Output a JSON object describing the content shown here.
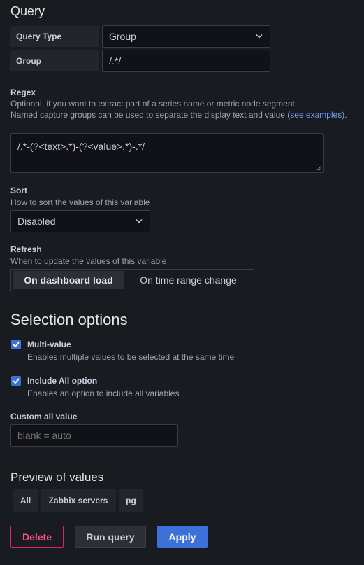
{
  "query": {
    "title": "Query",
    "query_type_label": "Query Type",
    "query_type_value": "Group",
    "group_label": "Group",
    "group_value": "/.*/"
  },
  "regex": {
    "label": "Regex",
    "help_line1": "Optional, if you want to extract part of a series name or metric node segment.",
    "help_line2_prefix": "Named capture groups can be used to separate the display text and value (",
    "help_link": "see examples",
    "help_suffix": ").",
    "value": "/.*-(?<text>.*)-(?<value>.*)-.*/"
  },
  "sort": {
    "label": "Sort",
    "help": "How to sort the values of this variable",
    "value": "Disabled"
  },
  "refresh": {
    "label": "Refresh",
    "help": "When to update the values of this variable",
    "options": [
      "On dashboard load",
      "On time range change"
    ],
    "selected": "On dashboard load"
  },
  "selection": {
    "title": "Selection options",
    "multi_value_label": "Multi-value",
    "multi_value_help": "Enables multiple values to be selected at the same time",
    "multi_value_checked": true,
    "include_all_label": "Include All option",
    "include_all_help": "Enables an option to include all variables",
    "include_all_checked": true,
    "custom_all_label": "Custom all value",
    "custom_all_placeholder": "blank = auto"
  },
  "preview": {
    "title": "Preview of values",
    "values": [
      "All",
      "Zabbix servers",
      "pg"
    ]
  },
  "actions": {
    "delete_label": "Delete",
    "run_label": "Run query",
    "apply_label": "Apply"
  },
  "colors": {
    "background": "#181b1f",
    "accent": "#3d71d9",
    "danger": "#e0226e",
    "link": "#6e9fff"
  }
}
